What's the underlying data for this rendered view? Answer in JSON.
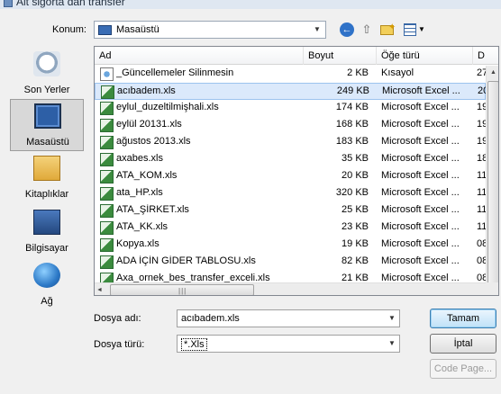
{
  "title": "Alt sigorta dan transfer",
  "location": {
    "label": "Konum:",
    "value": "Masaüstü"
  },
  "places": [
    {
      "label": "Son Yerler",
      "icon": "recent-places-icon",
      "selected": false
    },
    {
      "label": "Masaüstü",
      "icon": "desktop-icon",
      "selected": true
    },
    {
      "label": "Kitaplıklar",
      "icon": "libraries-icon",
      "selected": false
    },
    {
      "label": "Bilgisayar",
      "icon": "computer-icon",
      "selected": false
    },
    {
      "label": "Ağ",
      "icon": "network-icon",
      "selected": false
    }
  ],
  "columns": [
    "Ad",
    "Boyut",
    "Öğe türü",
    "D"
  ],
  "files": [
    {
      "name": "_Güncellemeler Silinmesin",
      "size": "2 KB",
      "type": "Kısayol",
      "date": "27",
      "icon": "shortcut-icon"
    },
    {
      "name": "acıbadem.xls",
      "size": "249 KB",
      "type": "Microsoft Excel ...",
      "date": "20",
      "icon": "excel-file-icon",
      "selected": true
    },
    {
      "name": "eylul_duzeltilmişhali.xls",
      "size": "174 KB",
      "type": "Microsoft Excel ...",
      "date": "19",
      "icon": "excel-file-icon"
    },
    {
      "name": "eylül 20131.xls",
      "size": "168 KB",
      "type": "Microsoft Excel ...",
      "date": "19",
      "icon": "excel-file-icon"
    },
    {
      "name": "ağustos 2013.xls",
      "size": "183 KB",
      "type": "Microsoft Excel ...",
      "date": "19",
      "icon": "excel-file-icon"
    },
    {
      "name": "axabes.xls",
      "size": "35 KB",
      "type": "Microsoft Excel ...",
      "date": "18",
      "icon": "excel-file-icon"
    },
    {
      "name": "ATA_KOM.xls",
      "size": "20 KB",
      "type": "Microsoft Excel ...",
      "date": "11",
      "icon": "excel-file-icon"
    },
    {
      "name": "ata_HP.xls",
      "size": "320 KB",
      "type": "Microsoft Excel ...",
      "date": "11",
      "icon": "excel-file-icon"
    },
    {
      "name": "ATA_ŞİRKET.xls",
      "size": "25 KB",
      "type": "Microsoft Excel ...",
      "date": "11",
      "icon": "excel-file-icon"
    },
    {
      "name": "ATA_KK.xls",
      "size": "23 KB",
      "type": "Microsoft Excel ...",
      "date": "11",
      "icon": "excel-file-icon"
    },
    {
      "name": "Kopya.xls",
      "size": "19 KB",
      "type": "Microsoft Excel ...",
      "date": "08",
      "icon": "excel-file-icon"
    },
    {
      "name": "ADA İÇİN GİDER TABLOSU.xls",
      "size": "82 KB",
      "type": "Microsoft Excel ...",
      "date": "08",
      "icon": "excel-file-icon"
    },
    {
      "name": "Axa_ornek_bes_transfer_exceli.xls",
      "size": "21 KB",
      "type": "Microsoft Excel ...",
      "date": "08",
      "icon": "excel-file-icon"
    }
  ],
  "filename": {
    "label": "Dosya adı:",
    "value": "acıbadem.xls"
  },
  "filetype": {
    "label": "Dosya türü:",
    "value": "*.Xls"
  },
  "buttons": {
    "ok": "Tamam",
    "cancel": "İptal",
    "codepage": "Code Page..."
  }
}
